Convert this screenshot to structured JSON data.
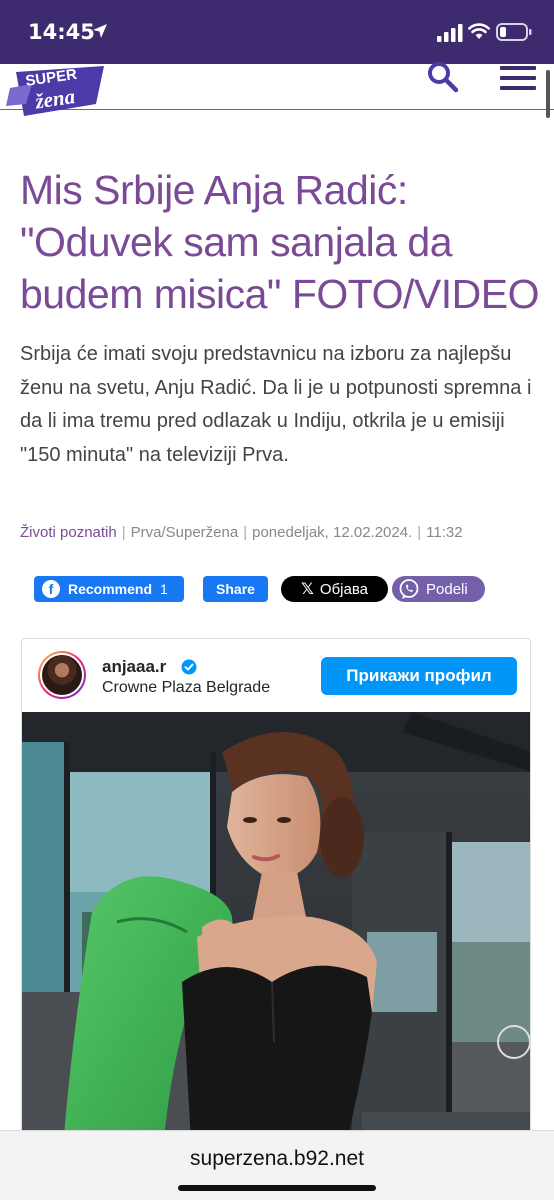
{
  "status_bar": {
    "time": "14:45",
    "bg_color": "#3e2a6e",
    "icons": [
      "location-arrow-icon",
      "cellular-signal-icon",
      "wifi-icon",
      "battery-low-icon"
    ]
  },
  "site": {
    "logo_top": "SUPER",
    "logo_bottom": "žena",
    "accent_color": "#7b4a96",
    "nav_color": "#3e2a6e"
  },
  "article": {
    "headline": "Mis Srbije Anja Radić: \"Oduvek sam sanjala da budem misica\" FOTO/VIDEO",
    "lead": "Srbija će imati svoju predstavnicu na izboru za najlepšu ženu na svetu, Anju Radić. Da li je u potpunosti spremna i da li ima tremu pred odlazak u Indiju, otkrila je u emisiji \"150 minuta\" na televiziji Prva.",
    "category": "Životi poznatih",
    "source": "Prva/Superžena",
    "date": "ponedeljak, 12.02.2024.",
    "time": "11:32"
  },
  "share": {
    "fb_recommend_label": "Recommend",
    "fb_recommend_count": "1",
    "fb_share_label": "Share",
    "x_label": "Објава",
    "viber_label": "Podeli"
  },
  "instagram": {
    "username": "anjaaa.r",
    "location": "Crowne Plaza Belgrade",
    "view_profile_label": "Прикажи профил"
  },
  "browser": {
    "url": "superzena.b92.net"
  }
}
